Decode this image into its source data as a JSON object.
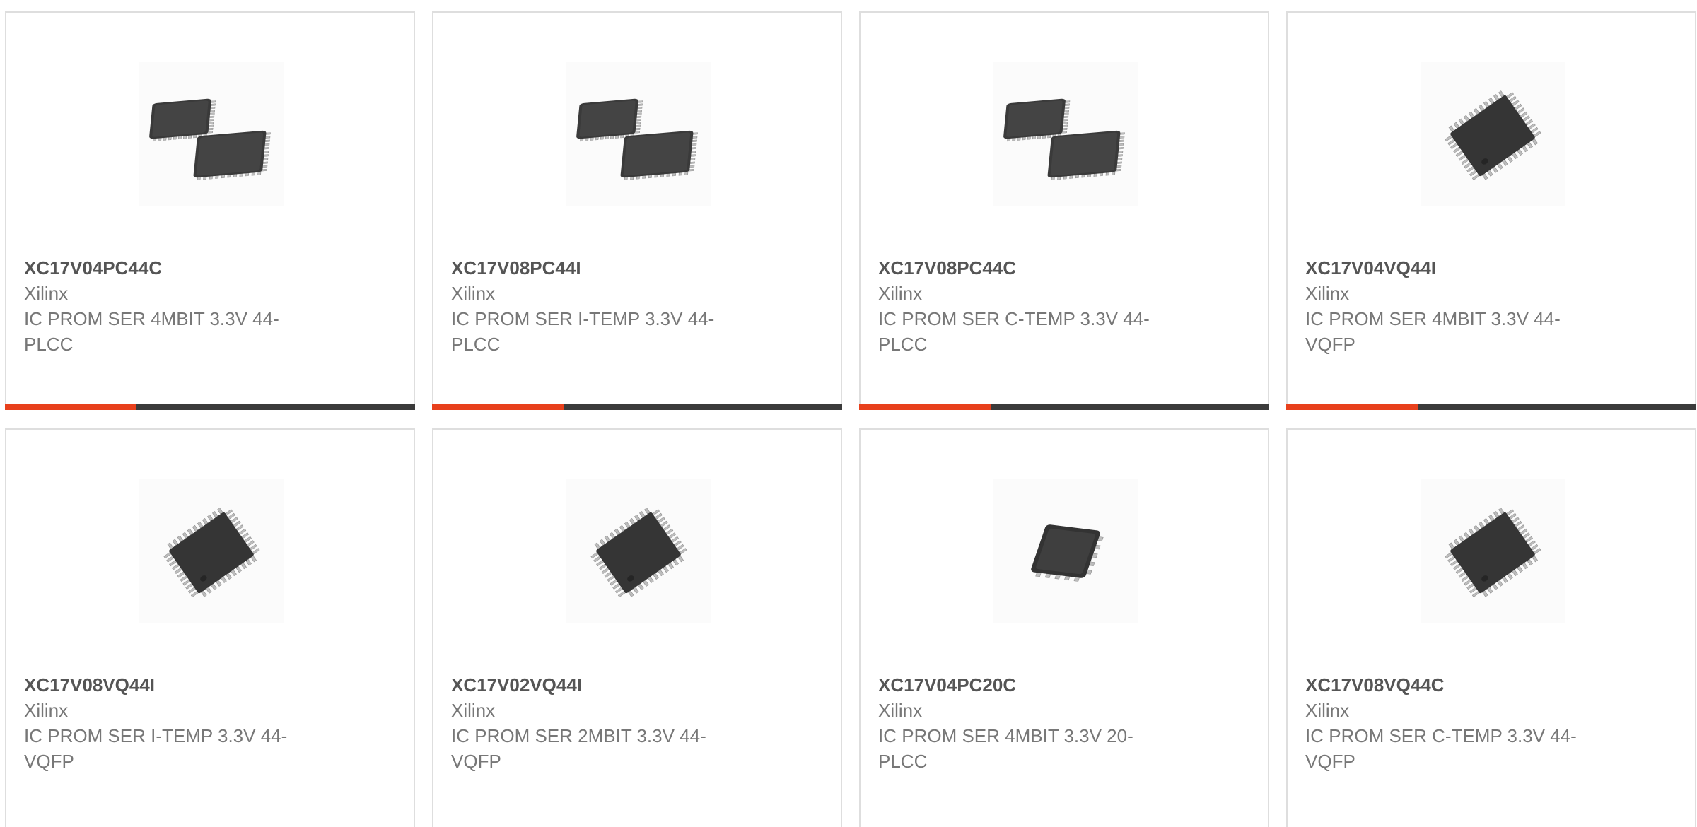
{
  "colors": {
    "accent": "#e8401c",
    "track": "#3b3b3b",
    "border": "#dedede",
    "part_text": "#555555",
    "body_text": "#777777"
  },
  "products": [
    {
      "part": "XC17V04PC44C",
      "maker": "Xilinx",
      "desc": "IC PROM SER 4MBIT 3.3V 44-PLCC",
      "image": "plcc-44-chip-pair-icon",
      "progress": 0.32
    },
    {
      "part": "XC17V08PC44I",
      "maker": "Xilinx",
      "desc": "IC PROM SER I-TEMP 3.3V 44-PLCC",
      "image": "plcc-44-chip-pair-icon",
      "progress": 0.32
    },
    {
      "part": "XC17V08PC44C",
      "maker": "Xilinx",
      "desc": "IC PROM SER C-TEMP 3.3V 44-PLCC",
      "image": "plcc-44-chip-pair-icon",
      "progress": 0.32
    },
    {
      "part": "XC17V04VQ44I",
      "maker": "Xilinx",
      "desc": "IC PROM SER 4MBIT 3.3V 44-VQFP",
      "image": "vqfp-44-chip-icon",
      "progress": 0.32
    },
    {
      "part": "XC17V08VQ44I",
      "maker": "Xilinx",
      "desc": "IC PROM SER I-TEMP 3.3V 44-VQFP",
      "image": "vqfp-44-chip-icon"
    },
    {
      "part": "XC17V02VQ44I",
      "maker": "Xilinx",
      "desc": "IC PROM SER 2MBIT 3.3V 44-VQFP",
      "image": "vqfp-44-chip-icon"
    },
    {
      "part": "XC17V04PC20C",
      "maker": "Xilinx",
      "desc": "IC PROM SER 4MBIT 3.3V 20-PLCC",
      "image": "plcc-20-chip-icon"
    },
    {
      "part": "XC17V08VQ44C",
      "maker": "Xilinx",
      "desc": "IC PROM SER C-TEMP 3.3V 44-VQFP",
      "image": "vqfp-44-chip-icon"
    }
  ]
}
